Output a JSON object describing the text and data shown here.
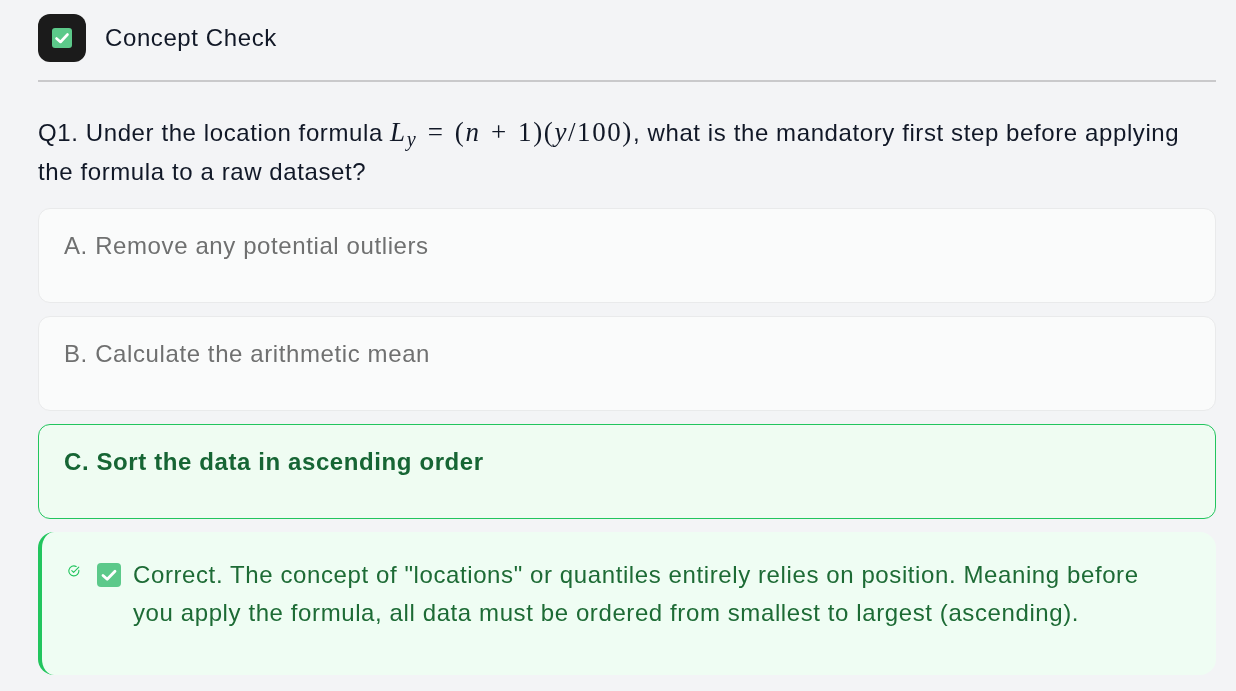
{
  "header": {
    "title": "Concept Check"
  },
  "question": {
    "text_before": "Q1. Under the location formula ",
    "formula": "*L*$_{y}$ = (*n* + 1)(*y*/100)",
    "text_after": ", what is the mandatory first step before applying the formula to a raw dataset?"
  },
  "options": [
    {
      "label": "A. Remove any potential outliers",
      "selected": false
    },
    {
      "label": "B. Calculate the arithmetic mean",
      "selected": false
    },
    {
      "label": "C. Sort the data in ascending order",
      "selected": true
    }
  ],
  "feedback": {
    "kind": "correct",
    "text": "Correct. The concept of \"locations\" or quantiles entirely relies on position. Meaning before you apply the formula, all data must be ordered from smallest to largest (ascending)."
  }
}
